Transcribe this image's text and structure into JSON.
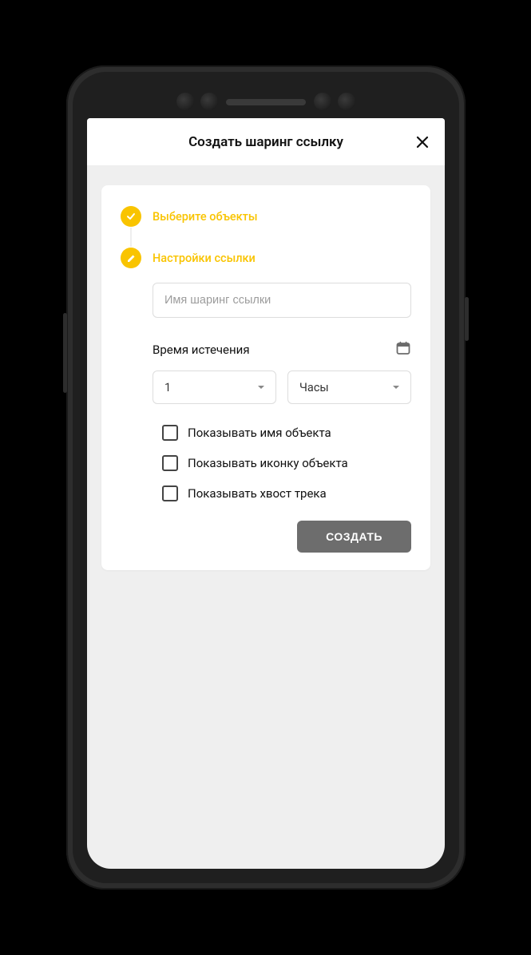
{
  "header": {
    "title": "Создать шаринг ссылку"
  },
  "steps": {
    "select_objects": "Выберите объекты",
    "link_settings": "Настройки ссылки"
  },
  "form": {
    "name_placeholder": "Имя шаринг ссылки",
    "expiration_label": "Время истечения",
    "duration_value": "1",
    "unit_value": "Часы"
  },
  "checks": {
    "show_name": "Показывать имя объекта",
    "show_icon": "Показывать иконку объекта",
    "show_tail": "Показывать хвост трека"
  },
  "actions": {
    "create": "СОЗДАТЬ"
  }
}
